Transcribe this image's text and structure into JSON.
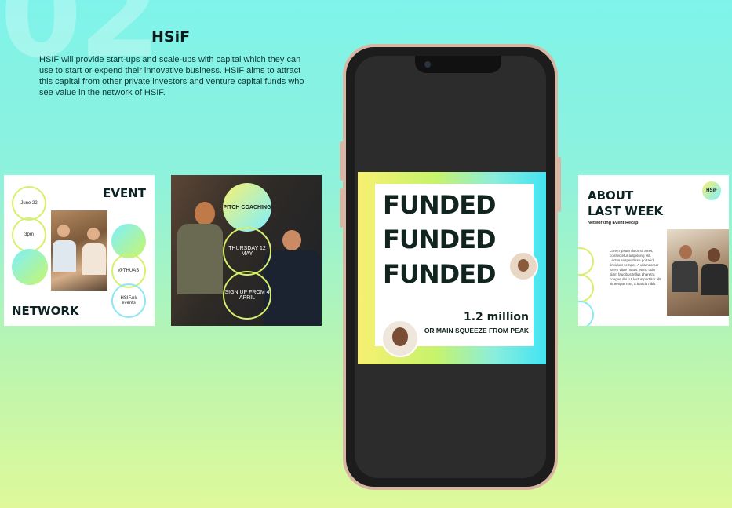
{
  "background_number": "02",
  "brand": "HSiF",
  "description": "HSIF will provide start-ups and scale-ups with capital which they can use to start or expend their innovative business. HSIF aims to attract this capital from other private investors and venture capital funds who see value in the network of HSIF.",
  "card_event": {
    "title": "EVENT",
    "date": "June 22",
    "time": "3pm",
    "handle": "@THUAS",
    "events_link": "HSIF.nl/ events",
    "footer": "NETWORK"
  },
  "card_pitch": {
    "circle1": "PITCH COACHING",
    "circle2": "THURSDAY 12 MAY",
    "circle3": "SIGN UP FROM 4 APRIL"
  },
  "phone_post": {
    "line1": "FUNDED",
    "line2": "FUNDED",
    "line3": "FUNDED",
    "amount": "1.2 million",
    "caption": "OR MAIN SQUEEZE FROM PEAK"
  },
  "card_recap": {
    "title_line1": "ABOUT",
    "title_line2": "LAST WEEK",
    "subtitle": "Networking Event Recap",
    "badge": "HSiF",
    "body": "Lorem ipsum dolor sit amet, consectetur adipiscing elit. Lectus suspendisse porta id tincidunt semper. A ullamcorper lorem vitae mattis. Nunc odio diam faucibus tellus pharetra congue dui. Ut lectus porttitor elit sit tempor non, a blandit nibh."
  },
  "colors": {
    "lime": "#d5f06a",
    "cyan": "#39e2f5",
    "dark_text": "#12241f"
  }
}
